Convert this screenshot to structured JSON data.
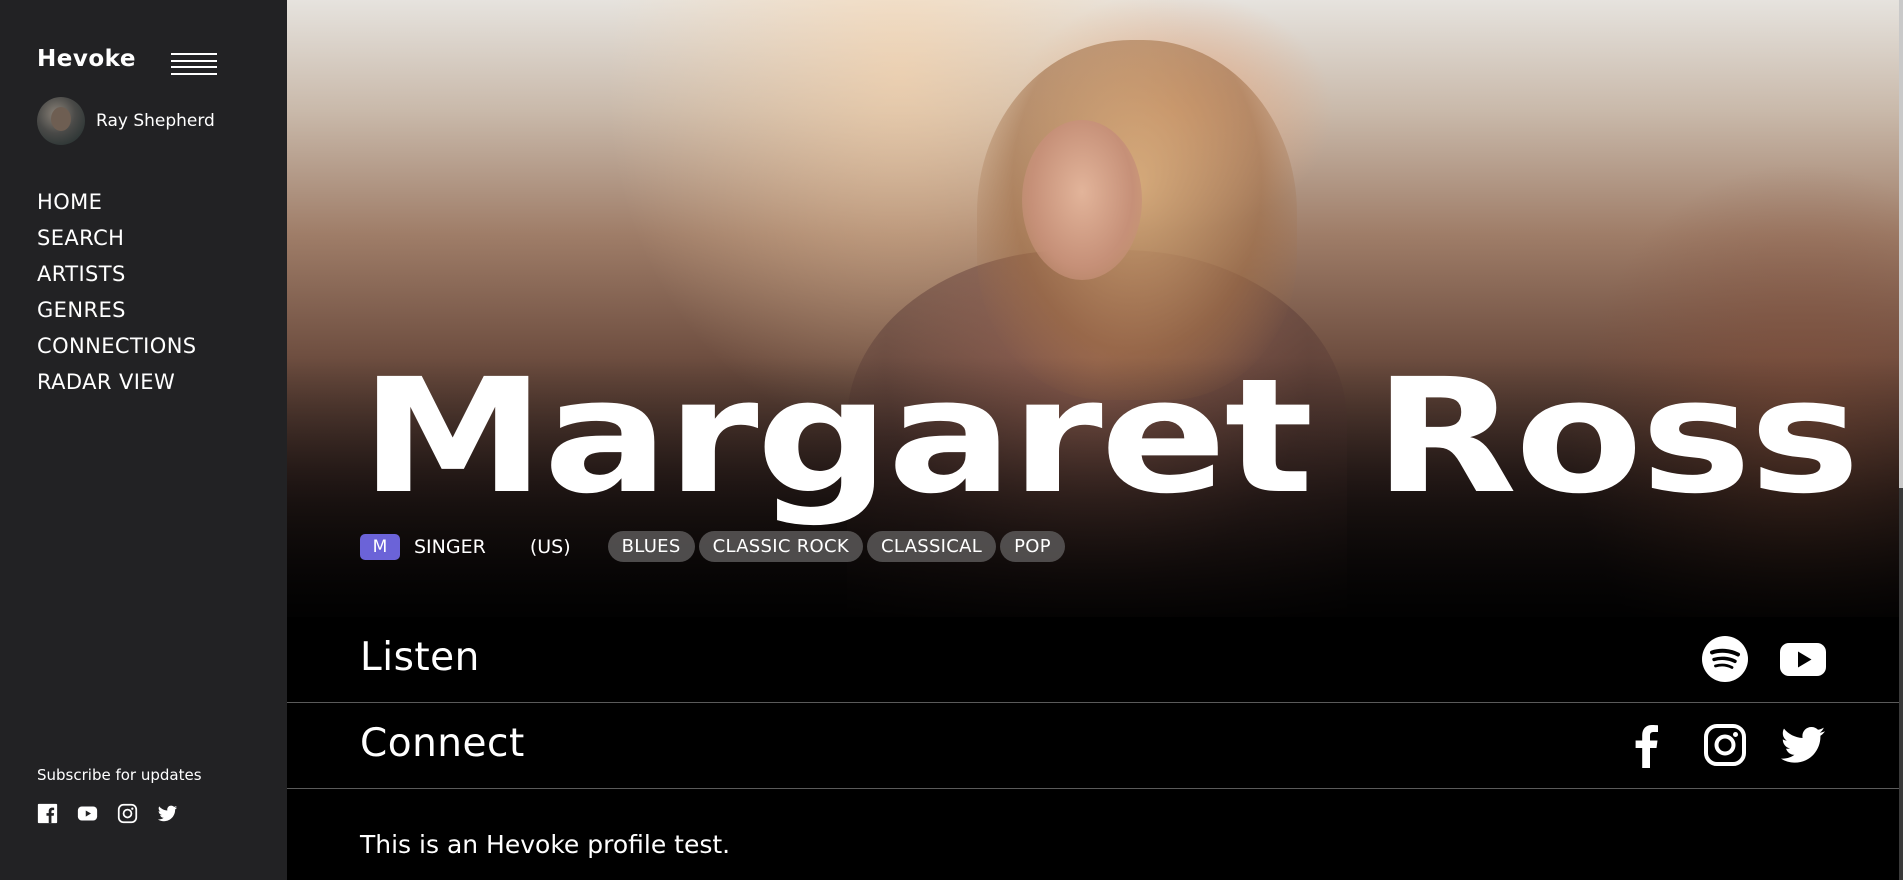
{
  "sidebar": {
    "logo": "Hevoke",
    "user": {
      "name": "Ray Shepherd"
    },
    "nav": [
      "HOME",
      "SEARCH",
      "ARTISTS",
      "GENRES",
      "CONNECTIONS",
      "RADAR VIEW"
    ],
    "subscribe_label": "Subscribe for updates",
    "social_icons": [
      "facebook-icon",
      "youtube-icon",
      "instagram-icon",
      "twitter-icon"
    ]
  },
  "artist": {
    "name": "Margaret Ross",
    "badge": "M",
    "role": "SINGER",
    "country": "(US)",
    "genres": [
      "BLUES",
      "CLASSIC ROCK",
      "CLASSICAL",
      "POP"
    ],
    "description": "This is an Hevoke profile test."
  },
  "sections": {
    "listen": {
      "title": "Listen",
      "icons": [
        "spotify-icon",
        "youtube-icon"
      ]
    },
    "connect": {
      "title": "Connect",
      "icons": [
        "facebook-icon",
        "instagram-icon",
        "twitter-icon"
      ]
    }
  },
  "colors": {
    "sidebar_bg": "#222224",
    "badge_accent": "#6b63d8",
    "tag_bg": "#5a5858"
  }
}
